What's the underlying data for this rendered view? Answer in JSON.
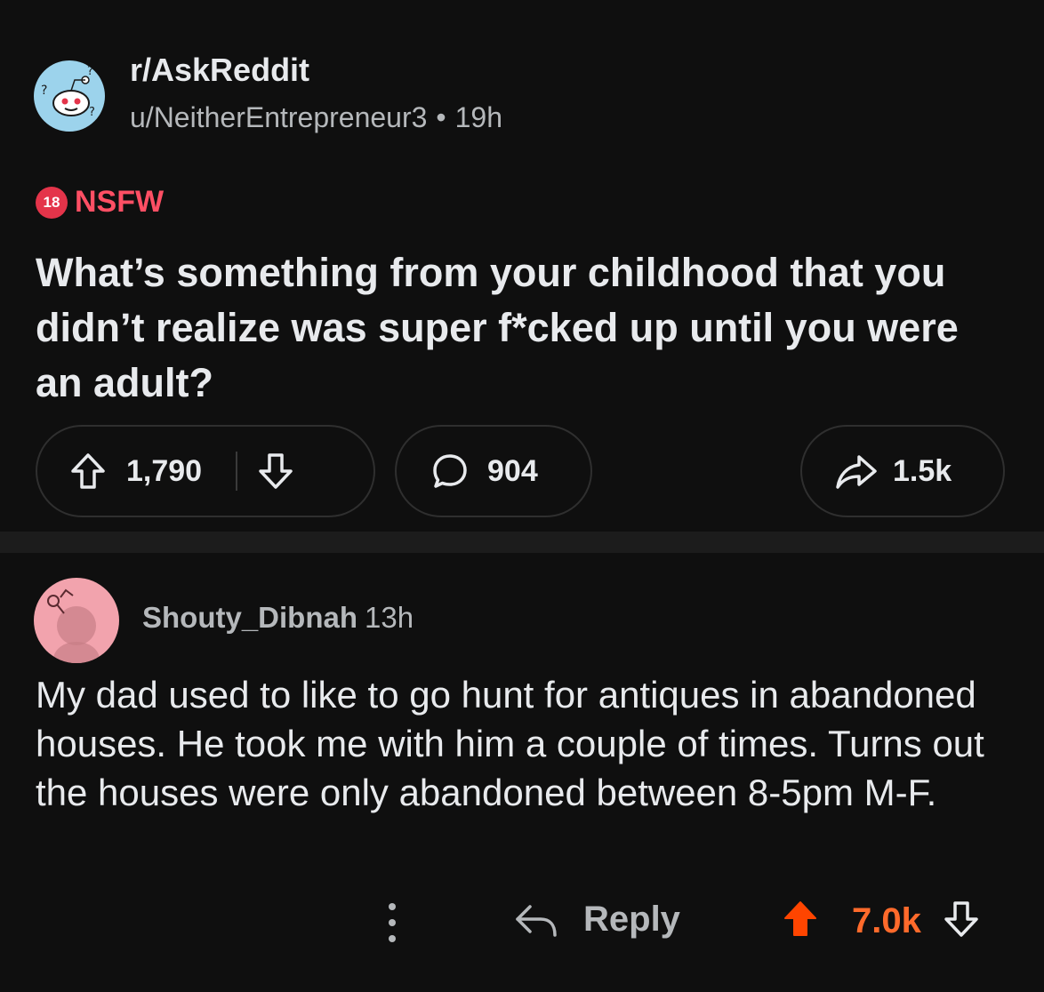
{
  "post": {
    "subreddit": "r/AskReddit",
    "author": "u/NeitherEntrepreneur3",
    "separator": "•",
    "age": "19h",
    "nsfw_badge": "18",
    "nsfw_label": "NSFW",
    "title": "What’s something from your childhood that you didn’t realize was super f*cked up until you were an adult?",
    "upvotes": "1,790",
    "comments": "904",
    "shares": "1.5k",
    "icons": {
      "upvote": "arrow-up-outline-icon",
      "downvote": "arrow-down-outline-icon",
      "comment": "speech-bubble-icon",
      "share": "share-arrow-icon"
    }
  },
  "comment": {
    "username": "Shouty_Dibnah",
    "age": "13h",
    "body": "My dad used to like to go hunt for antiques in abandoned houses.  He took me with him a couple of times.  Turns out the houses were only abandoned between 8-5pm M-F.",
    "reply_label": "Reply",
    "votes": "7.0k",
    "upvote_color": "#ff4500",
    "icons": {
      "more": "vertical-dots-icon",
      "reply": "reply-arrow-icon",
      "upvote": "filled-upvote-icon",
      "downvote": "arrow-down-outline-icon"
    }
  },
  "colors": {
    "background": "#0f0f0f",
    "nsfw": "#ff4f64",
    "vote_accent": "#ff6a2b"
  }
}
